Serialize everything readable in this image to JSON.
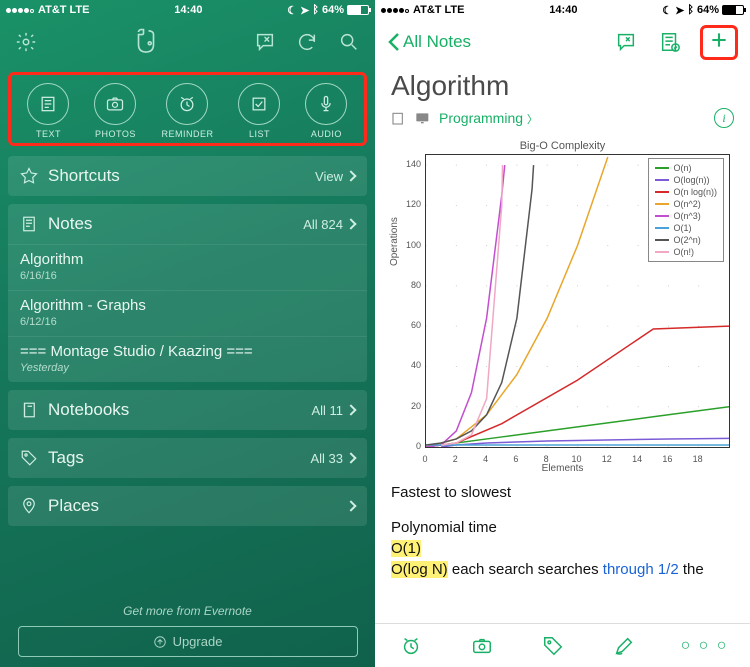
{
  "status": {
    "carrier": "AT&T",
    "network": "LTE",
    "time": "14:40",
    "battery_pct": "64%"
  },
  "left": {
    "quick": [
      {
        "label": "TEXT"
      },
      {
        "label": "PHOTOS"
      },
      {
        "label": "REMINDER"
      },
      {
        "label": "LIST"
      },
      {
        "label": "AUDIO"
      }
    ],
    "shortcuts": {
      "title": "Shortcuts",
      "action": "View"
    },
    "notes": {
      "title": "Notes",
      "count": "All 824",
      "items": [
        {
          "title": "Algorithm",
          "date": "6/16/16"
        },
        {
          "title": "Algorithm - Graphs",
          "date": "6/12/16"
        },
        {
          "title": "=== Montage Studio / Kaazing ===",
          "date": "Yesterday"
        }
      ]
    },
    "notebooks": {
      "title": "Notebooks",
      "count": "All 11"
    },
    "tags": {
      "title": "Tags",
      "count": "All 33"
    },
    "places": {
      "title": "Places"
    },
    "footer_msg": "Get more from Evernote",
    "upgrade": "Upgrade"
  },
  "right": {
    "back": "All Notes",
    "title": "Algorithm",
    "notebook": "Programming",
    "body": {
      "line1": "Fastest to slowest",
      "line2": "Polynomial time",
      "o1": "O(1)",
      "ologn": "O(log N)",
      "rest": " each search searches ",
      "link": "through 1/2",
      "tail": " the"
    }
  },
  "chart_data": {
    "type": "line",
    "title": "Big-O Complexity",
    "xlabel": "Elements",
    "ylabel": "Operations",
    "xlim": [
      0,
      20
    ],
    "ylim": [
      0,
      145
    ],
    "xticks": [
      0,
      2,
      4,
      6,
      8,
      10,
      12,
      14,
      16,
      18
    ],
    "yticks": [
      0,
      20,
      40,
      60,
      80,
      100,
      120,
      140
    ],
    "series": [
      {
        "name": "O(n)",
        "color": "#2aa02a",
        "x": [
          0,
          5,
          10,
          15,
          20
        ],
        "y": [
          0,
          5,
          10,
          15,
          20
        ]
      },
      {
        "name": "O(log(n))",
        "color": "#7b5bd6",
        "x": [
          1,
          2,
          4,
          8,
          16,
          20
        ],
        "y": [
          0,
          1,
          2,
          3,
          4,
          4.3
        ]
      },
      {
        "name": "O(n log(n))",
        "color": "#d42a2a",
        "x": [
          0,
          2,
          5,
          10,
          15,
          20
        ],
        "y": [
          0,
          2,
          11.6,
          33.2,
          58.6,
          60
        ]
      },
      {
        "name": "O(n^2)",
        "color": "#e9a62a",
        "x": [
          0,
          2,
          4,
          6,
          8,
          10,
          12
        ],
        "y": [
          0,
          4,
          16,
          36,
          64,
          100,
          144
        ]
      },
      {
        "name": "O(n^3)",
        "color": "#c24fcf",
        "x": [
          0,
          1,
          2,
          3,
          4,
          5,
          5.2
        ],
        "y": [
          0,
          1,
          8,
          27,
          64,
          125,
          140
        ]
      },
      {
        "name": "O(1)",
        "color": "#4aa2d6",
        "x": [
          0,
          20
        ],
        "y": [
          1,
          1
        ]
      },
      {
        "name": "O(2^n)",
        "color": "#555555",
        "x": [
          0,
          1,
          2,
          3,
          4,
          5,
          6,
          7,
          7.1
        ],
        "y": [
          1,
          2,
          4,
          8,
          16,
          32,
          64,
          128,
          140
        ]
      },
      {
        "name": "O(n!)",
        "color": "#f0a8c4",
        "x": [
          1,
          2,
          3,
          4,
          5,
          5.05
        ],
        "y": [
          1,
          2,
          6,
          24,
          120,
          140
        ]
      }
    ]
  }
}
